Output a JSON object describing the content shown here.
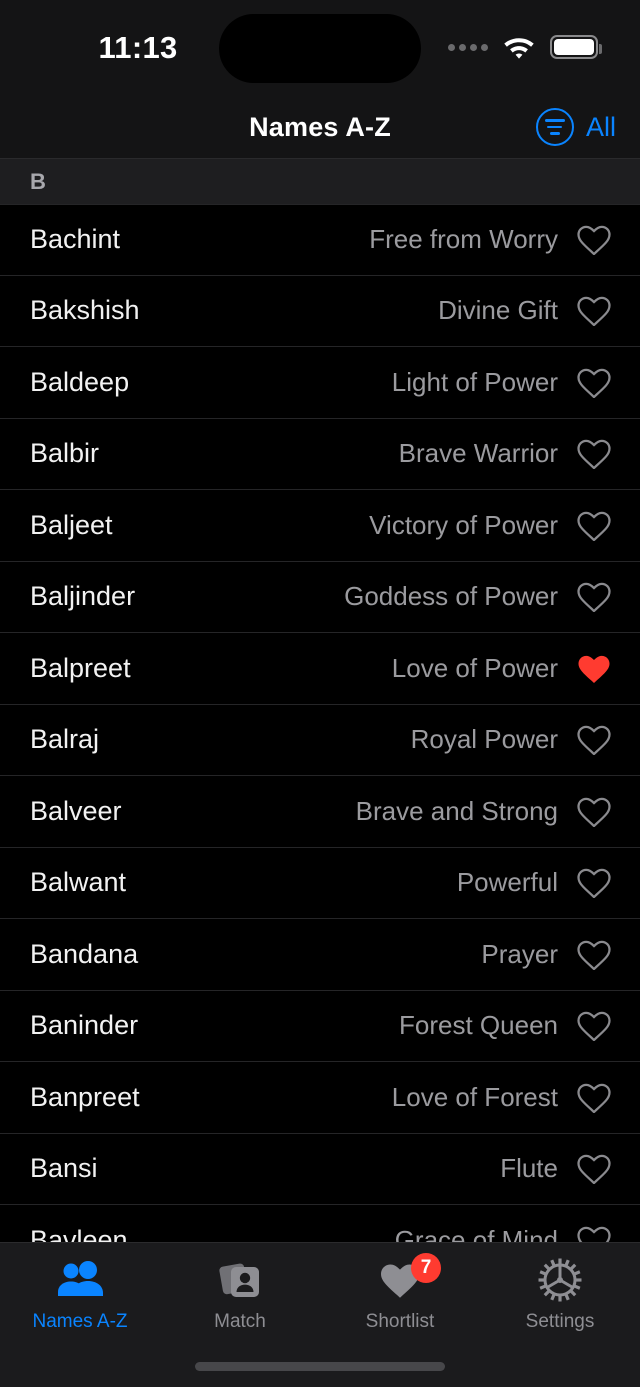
{
  "status_bar": {
    "time": "11:13",
    "cellular_icon": "cellular-dots-icon",
    "wifi_icon": "wifi-icon",
    "battery_icon": "battery-full-icon"
  },
  "nav_bar": {
    "title": "Names A-Z",
    "filter_icon": "filter-lines-circle-icon",
    "filter_label": "All",
    "accent_color": "#0A84FF"
  },
  "section": {
    "header": "B"
  },
  "list": {
    "heart_outline_icon": "heart-outline-icon",
    "heart_filled_icon": "heart-filled-icon",
    "favorite_color": "#FF3B30",
    "rows": [
      {
        "name": "Bachint",
        "meaning": "Free from Worry",
        "favorited": false
      },
      {
        "name": "Bakshish",
        "meaning": "Divine Gift",
        "favorited": false
      },
      {
        "name": "Baldeep",
        "meaning": "Light of Power",
        "favorited": false
      },
      {
        "name": "Balbir",
        "meaning": "Brave Warrior",
        "favorited": false
      },
      {
        "name": "Baljeet",
        "meaning": "Victory of Power",
        "favorited": false
      },
      {
        "name": "Baljinder",
        "meaning": "Goddess of Power",
        "favorited": false
      },
      {
        "name": "Balpreet",
        "meaning": "Love of Power",
        "favorited": true
      },
      {
        "name": "Balraj",
        "meaning": "Royal Power",
        "favorited": false
      },
      {
        "name": "Balveer",
        "meaning": "Brave and Strong",
        "favorited": false
      },
      {
        "name": "Balwant",
        "meaning": "Powerful",
        "favorited": false
      },
      {
        "name": "Bandana",
        "meaning": "Prayer",
        "favorited": false
      },
      {
        "name": "Baninder",
        "meaning": "Forest Queen",
        "favorited": false
      },
      {
        "name": "Banpreet",
        "meaning": "Love of Forest",
        "favorited": false
      },
      {
        "name": "Bansi",
        "meaning": "Flute",
        "favorited": false
      },
      {
        "name": "Bavleen",
        "meaning": "Grace of Mind",
        "favorited": false
      }
    ]
  },
  "tab_bar": {
    "tabs": [
      {
        "label": "Names A-Z",
        "icon": "two-people-icon",
        "active": true,
        "badge": null
      },
      {
        "label": "Match",
        "icon": "card-stack-person-icon",
        "active": false,
        "badge": null
      },
      {
        "label": "Shortlist",
        "icon": "heart-filled-icon",
        "active": false,
        "badge": "7"
      },
      {
        "label": "Settings",
        "icon": "gear-icon",
        "active": false,
        "badge": null
      }
    ]
  }
}
